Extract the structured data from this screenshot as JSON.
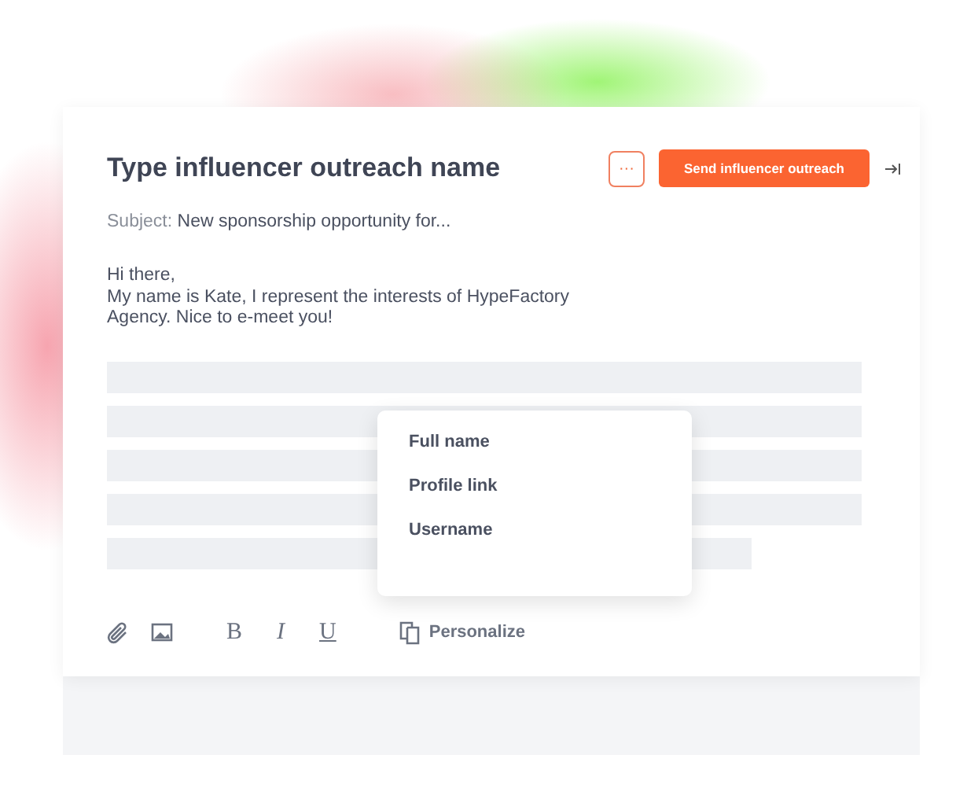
{
  "editor": {
    "title": "Type influencer outreach name",
    "more_button": "···",
    "send_button": "Send influencer outreach",
    "subject_label": "Subject:",
    "subject": "New sponsorship opportunity for...",
    "message_lines": [
      "Hi there,",
      "My name is Kate, I represent the interests of HypeFactory",
      "Agency. Nice to e-meet you!"
    ],
    "toolbar": [
      {
        "kind": "attach"
      },
      {
        "kind": "image"
      },
      {
        "kind": "text",
        "label": "B"
      },
      {
        "kind": "text",
        "label": "I"
      },
      {
        "kind": "text",
        "label": "U"
      },
      {
        "kind": "personalize",
        "label": "Personalize"
      }
    ]
  },
  "personalize_menu": {
    "items": [
      "Full name",
      "Profile link",
      "Username"
    ]
  }
}
